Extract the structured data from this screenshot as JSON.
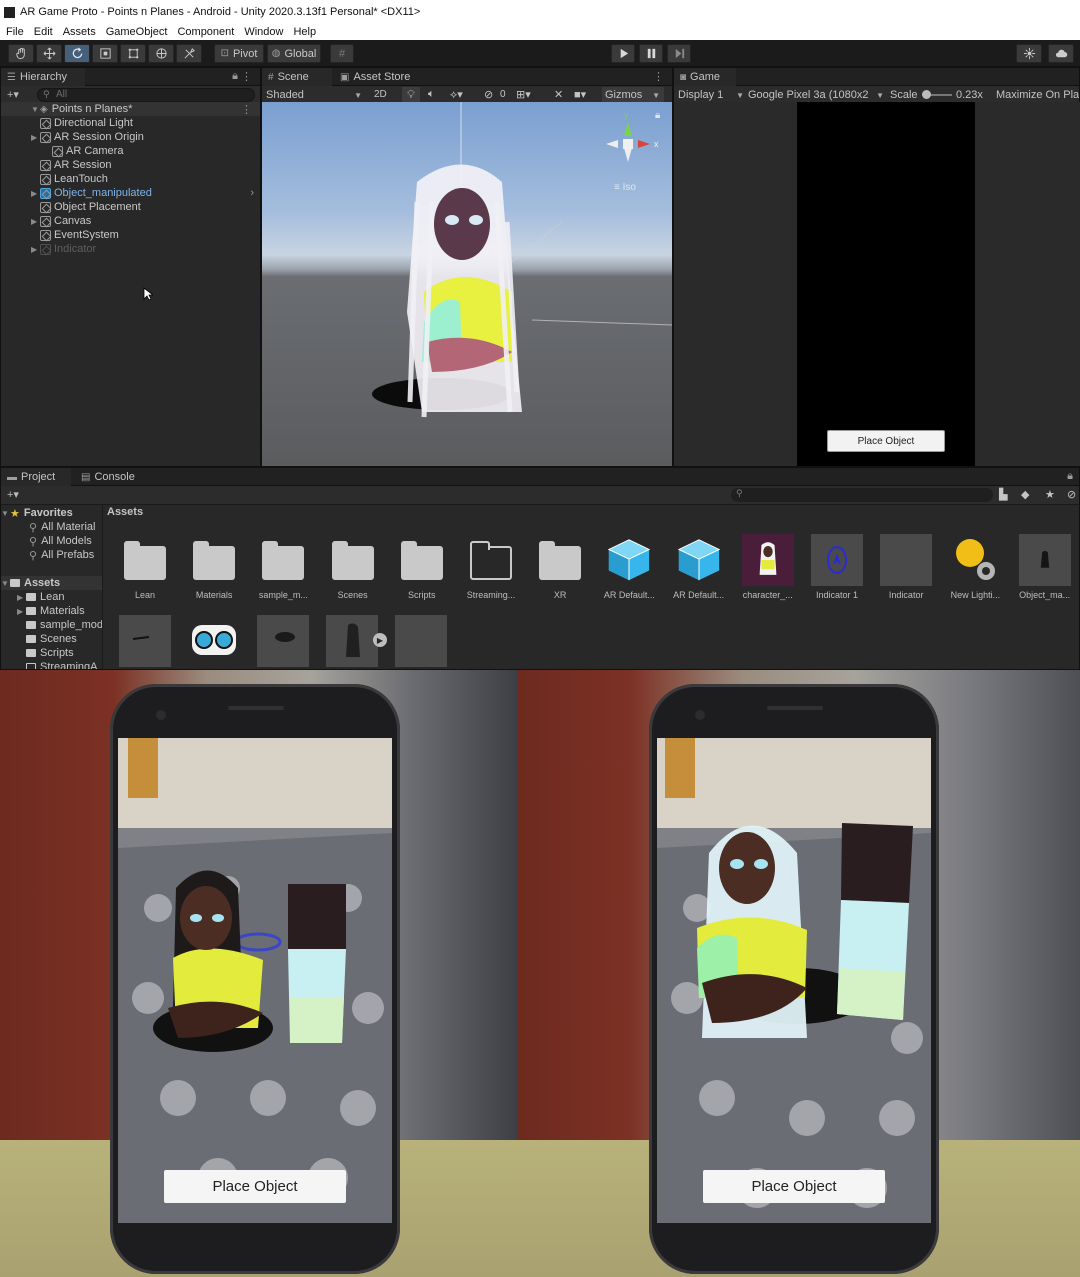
{
  "window": {
    "title": "AR Game Proto - Points n Planes - Android - Unity 2020.3.13f1 Personal* <DX11>"
  },
  "menu": [
    "File",
    "Edit",
    "Assets",
    "GameObject",
    "Component",
    "Window",
    "Help"
  ],
  "toolbar": {
    "pivot_label": "Pivot",
    "global_label": "Global"
  },
  "hierarchy": {
    "tab_label": "Hierarchy",
    "search_placeholder": "All",
    "scene_name": "Points n Planes*",
    "items": [
      {
        "label": "Directional Light",
        "depth": 1,
        "expandable": false
      },
      {
        "label": "AR Session Origin",
        "depth": 1,
        "expandable": true
      },
      {
        "label": "AR Camera",
        "depth": 2,
        "expandable": false
      },
      {
        "label": "AR Session",
        "depth": 1,
        "expandable": false
      },
      {
        "label": "LeanTouch",
        "depth": 1,
        "expandable": false
      },
      {
        "label": "Object_manipulated",
        "depth": 1,
        "expandable": true,
        "selected": true
      },
      {
        "label": "Object Placement",
        "depth": 1,
        "expandable": false
      },
      {
        "label": "Canvas",
        "depth": 1,
        "expandable": true
      },
      {
        "label": "EventSystem",
        "depth": 1,
        "expandable": false
      },
      {
        "label": "Indicator",
        "depth": 1,
        "expandable": true,
        "disabled": true
      }
    ]
  },
  "scene": {
    "tab_scene": "Scene",
    "tab_asset_store": "Asset Store",
    "shading_mode": "Shaded",
    "mode_2d": "2D",
    "hidden_count": "0",
    "gizmos_label": "Gizmos",
    "gizmo_x": "x",
    "gizmo_y": "y",
    "persp_label": "Iso"
  },
  "game": {
    "tab_label": "Game",
    "display_label": "Display 1",
    "resolution_label": "Google Pixel 3a (1080x2",
    "scale_label": "Scale",
    "scale_value": "0.23x",
    "maximize_label": "Maximize On Pla",
    "place_button": "Place Object"
  },
  "project": {
    "tab_project": "Project",
    "tab_console": "Console",
    "favorites_label": "Favorites",
    "favorites": [
      "All Material",
      "All Models",
      "All Prefabs"
    ],
    "assets_root": "Assets",
    "assets_tree": [
      "Lean",
      "Materials",
      "sample_mod",
      "Scenes",
      "Scripts",
      "StreamingA"
    ],
    "breadcrumb": "Assets",
    "grid_row1": [
      {
        "label": "Lean",
        "kind": "folder"
      },
      {
        "label": "Materials",
        "kind": "folder"
      },
      {
        "label": "sample_m...",
        "kind": "folder"
      },
      {
        "label": "Scenes",
        "kind": "folder"
      },
      {
        "label": "Scripts",
        "kind": "folder"
      },
      {
        "label": "Streaming...",
        "kind": "folder-outline"
      },
      {
        "label": "XR",
        "kind": "folder"
      },
      {
        "label": "AR Default...",
        "kind": "cube"
      },
      {
        "label": "AR Default...",
        "kind": "cube"
      },
      {
        "label": "character_...",
        "kind": "character"
      },
      {
        "label": "Indicator 1",
        "kind": "indicator"
      },
      {
        "label": "Indicator",
        "kind": "blank"
      },
      {
        "label": "New Lighti...",
        "kind": "lighting"
      },
      {
        "label": "Object_ma...",
        "kind": "object"
      }
    ]
  },
  "photos": {
    "left_button": "Place Object",
    "right_button": "Place Object"
  }
}
